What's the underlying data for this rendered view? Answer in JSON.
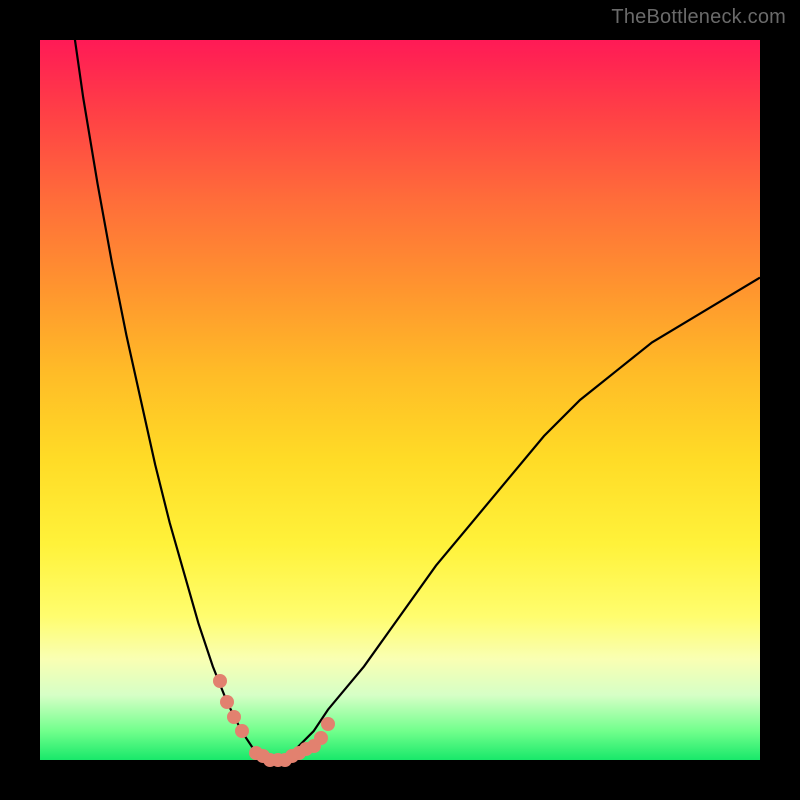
{
  "watermark_text": "TheBottleneck.com",
  "colors": {
    "page_bg": "#000000",
    "gradient_top": "#ff1a56",
    "gradient_bottom": "#18e86a",
    "curve_stroke": "#000000",
    "bead_fill": "#e2816f"
  },
  "chart_data": {
    "type": "line",
    "title": "",
    "xlabel": "",
    "ylabel": "",
    "xlim": [
      0,
      100
    ],
    "ylim": [
      0,
      100
    ],
    "note": "No axes, ticks, or numeric labels are rendered; x and y are inferred as 0–100 normalized ranges. y represents bottleneck percentage (top=100, bottom=0). The curve has a minimum near x≈32 at y≈0 and rises steeply to the left and gradually to the right.",
    "series": [
      {
        "name": "bottleneck-curve",
        "x": [
          0,
          2,
          4,
          6,
          8,
          10,
          12,
          14,
          16,
          18,
          20,
          22,
          24,
          26,
          28,
          30,
          32,
          34,
          36,
          38,
          40,
          45,
          50,
          55,
          60,
          65,
          70,
          75,
          80,
          85,
          90,
          95,
          100
        ],
        "y": [
          140,
          122,
          106,
          92,
          80,
          69,
          59,
          50,
          41,
          33,
          26,
          19,
          13,
          8,
          4,
          1,
          0,
          0,
          2,
          4,
          7,
          13,
          20,
          27,
          33,
          39,
          45,
          50,
          54,
          58,
          61,
          64,
          67
        ]
      }
    ],
    "beads": {
      "name": "highlight-beads",
      "note": "Pink circular markers clustered around the curve minimum.",
      "x": [
        25,
        26,
        27,
        28,
        30,
        31,
        32,
        33,
        34,
        35,
        36,
        37,
        38,
        39,
        40
      ],
      "y": [
        11,
        8,
        6,
        4,
        1,
        0.5,
        0,
        0,
        0,
        0.5,
        1,
        1.5,
        2,
        3,
        5
      ]
    }
  }
}
